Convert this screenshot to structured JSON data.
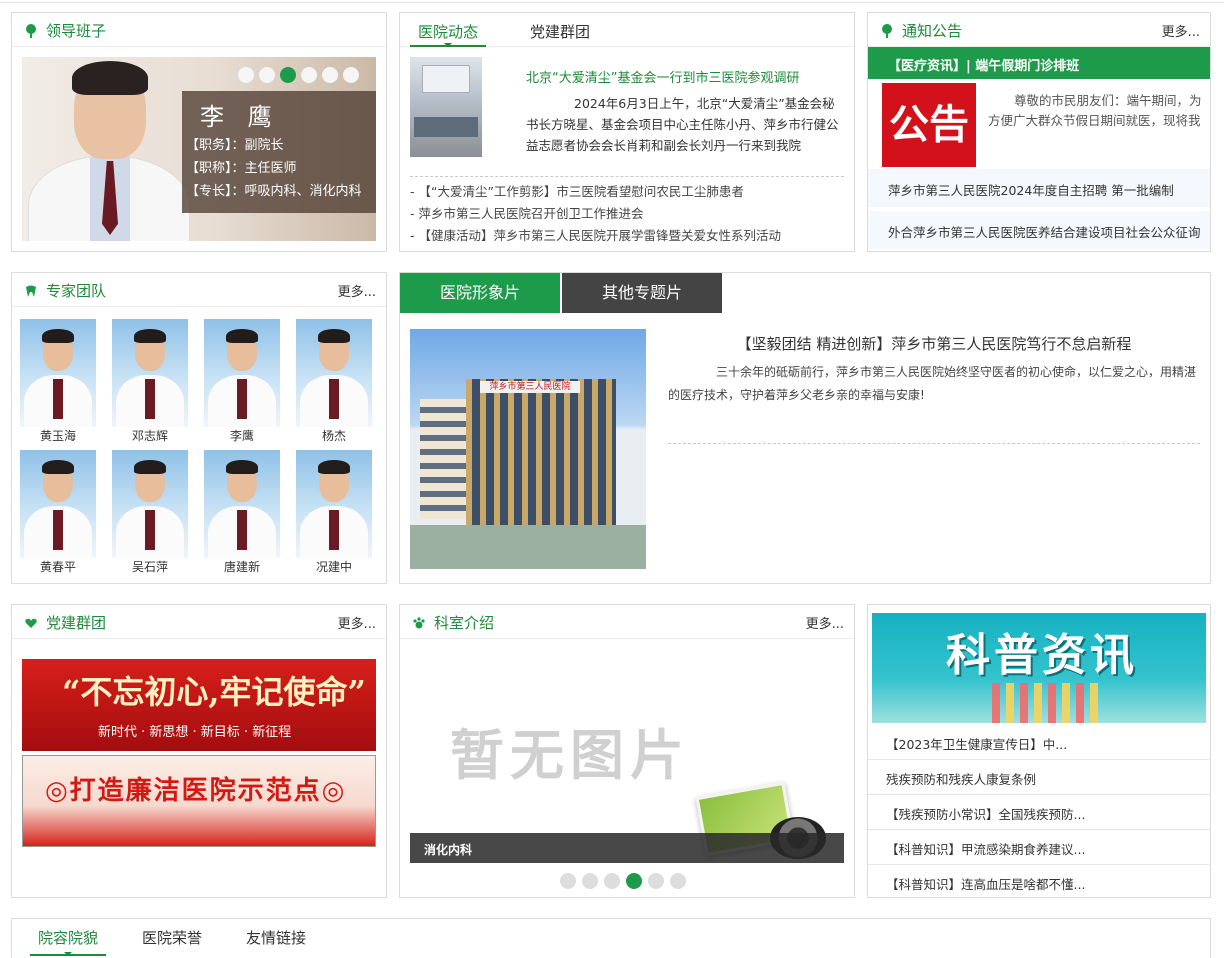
{
  "leaders": {
    "title": "领导班子",
    "name": "李 鹰",
    "lines": [
      "【职务】：副院长",
      "【职称】：主任医师",
      "【专长】：呼吸内科、消化内科"
    ]
  },
  "news": {
    "tabs": [
      "医院动态",
      "党建群团"
    ],
    "headline": "北京“大爱清尘”基金会一行到市三医院参观调研",
    "summary": "2024年6月3日上午，北京“大爱清尘”基金会秘书长方晓星、基金会项目中心主任陈小丹、萍乡市行健公益志愿者协会会长肖莉和副会长刘丹一行来到我院",
    "list": [
      "- 【“大爱清尘”工作剪影】市三医院看望慰问农民工尘肺患者",
      "- 萍乡市第三人民医院召开创卫工作推进会",
      "- 【健康活动】萍乡市第三人民医院开展学雷锋暨关爱女性系列活动"
    ]
  },
  "notice": {
    "title": "通知公告",
    "more": "更多...",
    "bar": "【医疗资讯】| 端午假期门诊排班",
    "badge": "公告",
    "text": "尊敬的市民朋友们：端午期间，为方便广大群众节假日期间就医，现将我",
    "items": [
      "萍乡市第三人民医院2024年度自主招聘 第一批编制",
      "外合萍乡市第三人民医院医养结合建设项目社会公众征询"
    ]
  },
  "experts": {
    "title": "专家团队",
    "more": "更多...",
    "names": [
      "黄玉海",
      "邓志辉",
      "李鹰",
      "杨杰",
      "黄春平",
      "吴石萍",
      "唐建新",
      "况建中"
    ]
  },
  "video": {
    "tabs": [
      "医院形象片",
      "其他专题片"
    ],
    "sign": "萍乡市第三人民医院",
    "title": "【坚毅团结 精进创新】萍乡市第三人民医院笃行不怠启新程",
    "text": "三十余年的砥砺前行，萍乡市第三人民医院始终坚守医者的初心使命，以仁爱之心，用精湛的医疗技术，守护着萍乡父老乡亲的幸福与安康!"
  },
  "party": {
    "title": "党建群团",
    "more": "更多...",
    "banner1_big": "“不忘初心,牢记使命”",
    "banner1_small": "新时代 · 新思想 · 新目标 · 新征程",
    "banner2_big": "◎打造廉洁医院示范点◎"
  },
  "dept": {
    "title": "科室介绍",
    "more": "更多...",
    "placeholder": "暂无图片",
    "caption": "消化内科"
  },
  "science": {
    "banner": "科普资讯",
    "items": [
      "【2023年卫生健康宣传日】中...",
      "残疾预防和残疾人康复条例",
      "【残疾预防小常识】全国残疾预防...",
      "【科普知识】甲流感染期食养建议...",
      "【科普知识】连高血压是啥都不懂..."
    ]
  },
  "bottom": {
    "tabs": [
      "院容院貌",
      "医院荣誉",
      "友情链接"
    ]
  },
  "colors": {
    "brand": "#1e9b4a",
    "text_green": "#1e8a3a",
    "red": "#d3111a"
  }
}
